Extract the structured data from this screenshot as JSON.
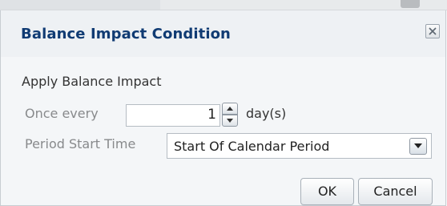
{
  "dialog": {
    "title": "Balance Impact Condition",
    "close_icon": "close-x-icon"
  },
  "form": {
    "section_label": "Apply Balance Impact",
    "once_every": {
      "label": "Once every",
      "value": "1",
      "unit": "day(s)"
    },
    "period_start": {
      "label": "Period Start Time",
      "selected": "Start Of Calendar Period"
    }
  },
  "buttons": {
    "ok": "OK",
    "cancel": "Cancel"
  },
  "colors": {
    "title": "#103b73",
    "disabled_label": "#888a8c",
    "background": "#f4f6f8"
  }
}
